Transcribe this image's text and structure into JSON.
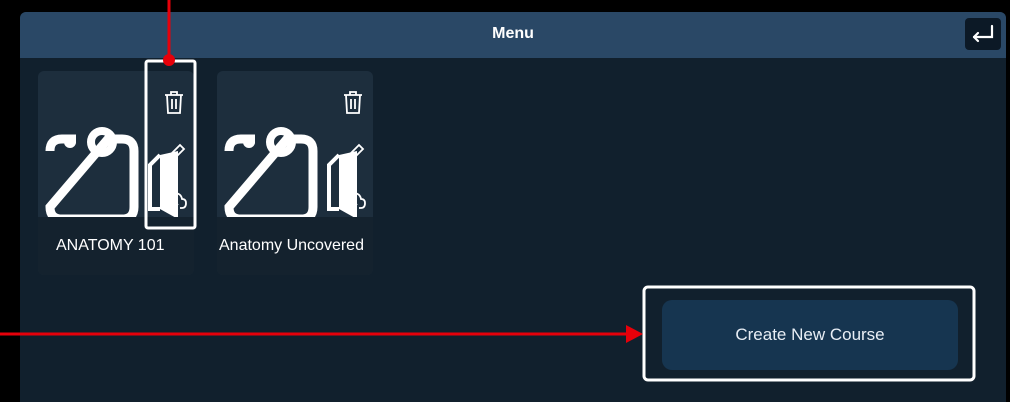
{
  "header": {
    "title": "Menu"
  },
  "courses": [
    {
      "name": "ANATOMY 101"
    },
    {
      "name": "Anatomy Uncovered"
    }
  ],
  "actions": {
    "create_label": "Create New Course"
  },
  "colors": {
    "panel": "#11202d",
    "header": "#2a4866",
    "card": "#1d2e3d",
    "button": "#163550",
    "highlight": "#e6000a"
  }
}
